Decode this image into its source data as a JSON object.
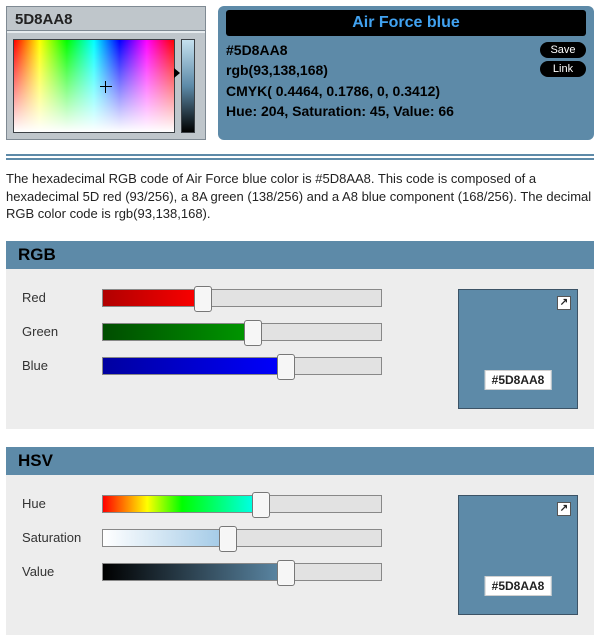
{
  "color": {
    "name": "Air Force blue",
    "hex_short": "5D8AA8",
    "hex_prefixed": "#5D8AA8",
    "rgb_text": "rgb(93,138,168)",
    "cmyk_text": "CMYK( 0.4464, 0.1786, 0, 0.3412)",
    "hsv_text": "Hue: 204, Saturation: 45, Value: 66",
    "swatch_hex": "#5D8AA8"
  },
  "actions": {
    "save": "Save",
    "link": "Link"
  },
  "description": "The hexadecimal RGB code of Air Force blue color is #5D8AA8. This code is composed of a hexadecimal 5D red (93/256), a 8A green (138/256) and a A8 blue component (168/256). The decimal RGB color code is rgb(93,138,168).",
  "sections": {
    "rgb": {
      "title": "RGB",
      "channels": {
        "red": "Red",
        "green": "Green",
        "blue": "Blue"
      },
      "values": {
        "red": 93,
        "green": 138,
        "blue": 168
      },
      "max": 256,
      "swatch_label": "#5D8AA8"
    },
    "hsv": {
      "title": "HSV",
      "channels": {
        "hue": "Hue",
        "sat": "Saturation",
        "val": "Value"
      },
      "values": {
        "hue": 204,
        "sat": 45,
        "val": 66
      },
      "swatch_label": "#5D8AA8"
    }
  },
  "chart_data": [
    {
      "type": "bar",
      "title": "RGB",
      "categories": [
        "Red",
        "Green",
        "Blue"
      ],
      "values": [
        93,
        138,
        168
      ],
      "ylim": [
        0,
        256
      ]
    },
    {
      "type": "bar",
      "title": "HSV",
      "categories": [
        "Hue",
        "Saturation",
        "Value"
      ],
      "values": [
        204,
        45,
        66
      ],
      "ylim": [
        0,
        360
      ]
    }
  ]
}
